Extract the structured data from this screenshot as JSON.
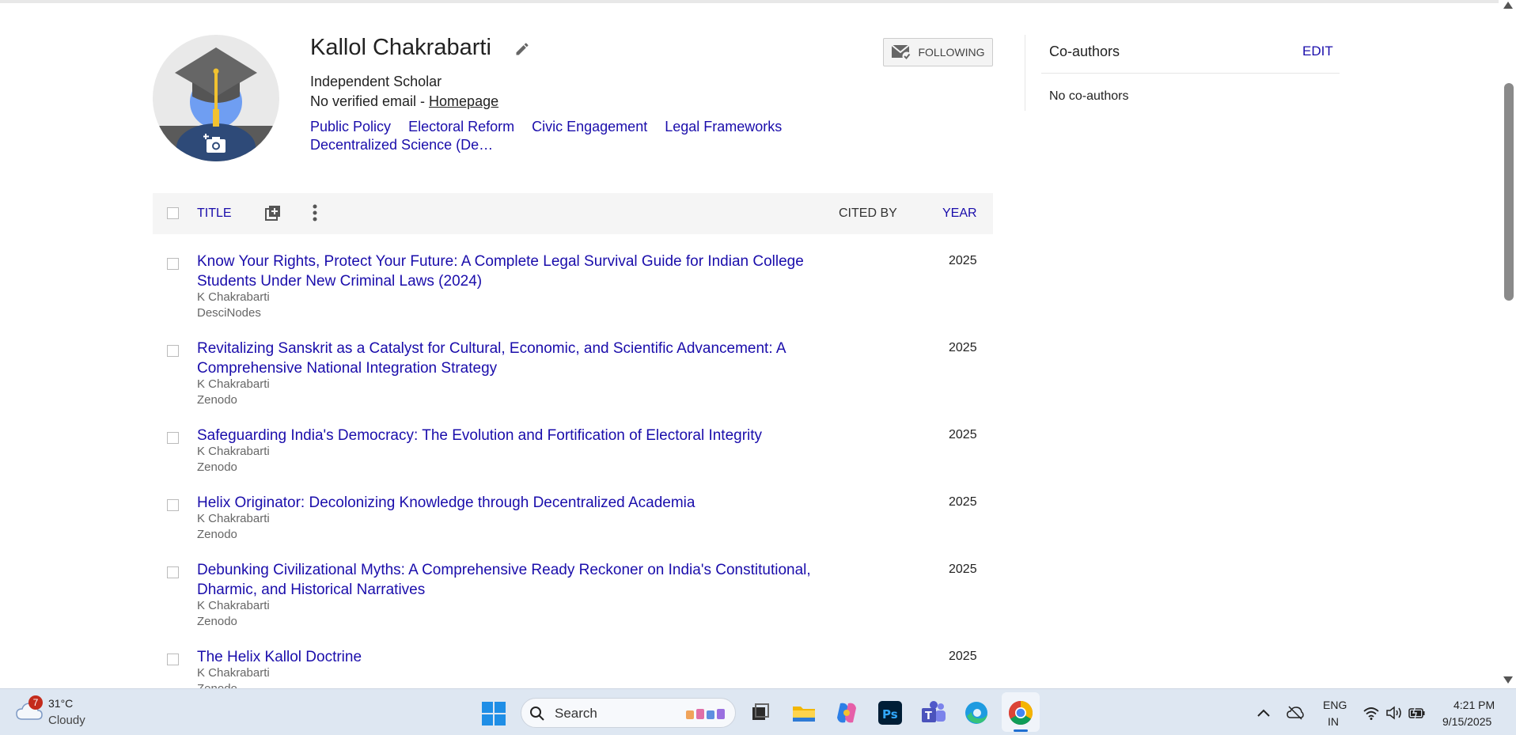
{
  "profile": {
    "name": "Kallol Chakrabarti",
    "affiliation": "Independent Scholar",
    "email_text": "No verified email - ",
    "homepage_label": "Homepage",
    "interests": [
      "Public Policy",
      "Electoral Reform",
      "Civic Engagement",
      "Legal Frameworks",
      "Decentralized Science (De…"
    ],
    "follow_label": "FOLLOWING"
  },
  "table": {
    "title_header": "TITLE",
    "cited_by_header": "CITED BY",
    "year_header": "YEAR"
  },
  "articles": [
    {
      "title": "Know Your Rights, Protect Your Future: A Complete Legal Survival Guide for Indian College Students Under New Criminal Laws (2024)",
      "authors": "K Chakrabarti",
      "venue": "DesciNodes",
      "year": "2025"
    },
    {
      "title": "Revitalizing Sanskrit as a Catalyst for Cultural, Economic, and Scientific Advancement: A Comprehensive National Integration Strategy",
      "authors": "K Chakrabarti",
      "venue": "Zenodo",
      "year": "2025"
    },
    {
      "title": "Safeguarding India's Democracy: The Evolution and Fortification of Electoral Integrity",
      "authors": "K Chakrabarti",
      "venue": "Zenodo",
      "year": "2025"
    },
    {
      "title": "Helix Originator: Decolonizing Knowledge through Decentralized Academia",
      "authors": "K Chakrabarti",
      "venue": "Zenodo",
      "year": "2025"
    },
    {
      "title": "Debunking Civilizational Myths: A Comprehensive Ready Reckoner on India's Constitutional, Dharmic, and Historical Narratives",
      "authors": "K Chakrabarti",
      "venue": "Zenodo",
      "year": "2025"
    },
    {
      "title": "The Helix Kallol Doctrine",
      "authors": "K Chakrabarti",
      "venue": "Zenodo",
      "year": "2025"
    }
  ],
  "coauthors": {
    "title": "Co-authors",
    "edit_label": "EDIT",
    "empty_text": "No co-authors"
  },
  "taskbar": {
    "weather_badge": "7",
    "temperature": "31°C",
    "condition": "Cloudy",
    "search_label": "Search",
    "lang_primary": "ENG",
    "lang_secondary": "IN",
    "time": "4:21 PM",
    "date": "9/15/2025"
  },
  "colors": {
    "link": "#1a0dab",
    "header_bg": "#f5f5f5",
    "taskbar_bg": "#dee7f2"
  }
}
